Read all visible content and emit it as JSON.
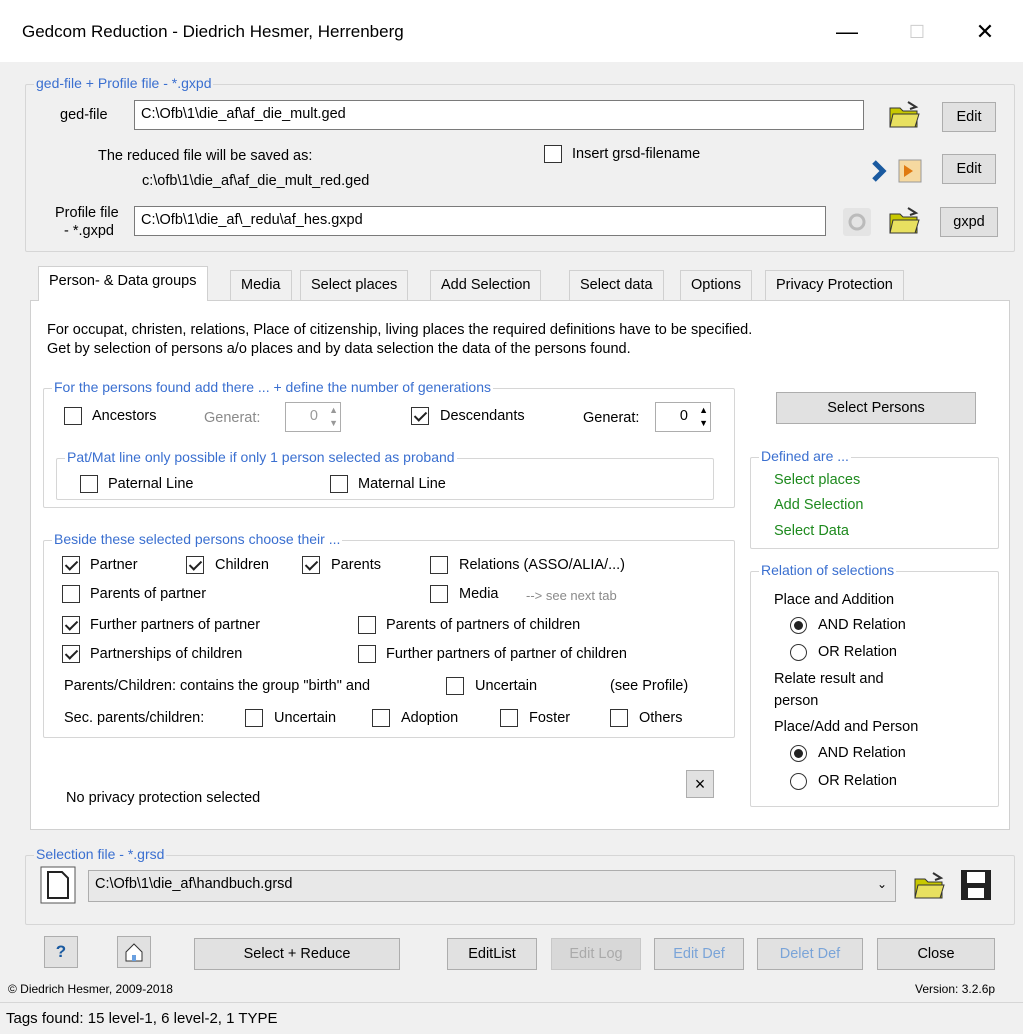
{
  "window": {
    "title": "Gedcom Reduction  -  Diedrich Hesmer, Herrenberg",
    "minimize": "—",
    "maximize": "☐",
    "close": "✕"
  },
  "files": {
    "legend": "ged-file + Profile file - *.gxpd",
    "ged_label": "ged-file",
    "ged_value": "C:\\Ofb\\1\\die_af\\af_die_mult.ged",
    "edit": "Edit",
    "saved_as_label": "The reduced file will be saved as:",
    "saved_as_value": "c:\\ofb\\1\\die_af\\af_die_mult_red.ged",
    "insert_grsd": "Insert grsd-filename",
    "profile_label_1": "Profile file",
    "profile_label_2": "- *.gxpd",
    "profile_value": "C:\\Ofb\\1\\die_af\\_redu\\af_hes.gxpd",
    "gxpd": "gxpd"
  },
  "tabs": [
    "Person- & Data groups",
    "Media",
    "Select places",
    "Add Selection",
    "Select data",
    "Options",
    "Privacy Protection"
  ],
  "intro": {
    "line1": "For occupat, christen, relations, Place of citizenship, living places the required definitions have to be specified.",
    "line2": "Get by selection of persons a/o places and by data selection the data of the persons found."
  },
  "generations": {
    "legend": "For the persons found add there ... + define the number of generations",
    "ancestors": "Ancestors",
    "generat_ancestors": "Generat:",
    "ancestors_value": "0",
    "descendants": "Descendants",
    "generat_descendants": "Generat:",
    "descendants_value": "0",
    "patmat_legend": "Pat/Mat line only possible if only 1 person selected as proband",
    "paternal": "Paternal Line",
    "maternal": "Maternal Line"
  },
  "beside": {
    "legend": "Beside these selected persons choose their ...",
    "partner": "Partner",
    "children": "Children",
    "parents": "Parents",
    "relations": "Relations (ASSO/ALIA/...)",
    "parents_of_partner": "Parents of partner",
    "media": "Media",
    "media_hint": "--> see next tab",
    "further_partners": "Further partners of partner",
    "parents_partners_children": "Parents of partners of children",
    "partnerships_children": "Partnerships of children",
    "further_partners_children": "Further partners of partner of children",
    "birth_text": "Parents/Children: contains the group \"birth\" and",
    "uncertain": "Uncertain",
    "see_profile": "(see Profile)",
    "sec_text": "Sec. parents/children:",
    "sec_uncertain": "Uncertain",
    "adoption": "Adoption",
    "foster": "Foster",
    "others": "Others"
  },
  "privacy": {
    "text": "No privacy protection selected",
    "clear": "×"
  },
  "right": {
    "select_persons": "Select Persons",
    "defined_legend": "Defined are ...",
    "defined_items": [
      "Select places",
      "Add Selection",
      "Select Data"
    ],
    "relation_legend": "Relation of selections",
    "place_addition": "Place and Addition",
    "and_relation_1": "AND Relation",
    "or_relation_1": "OR Relation",
    "relate_result_1": "Relate result and",
    "relate_result_2": "person",
    "place_add_person": "Place/Add and Person",
    "and_relation_2": "AND Relation",
    "or_relation_2": "OR Relation"
  },
  "selection": {
    "legend": "Selection file - *.grsd",
    "value": "C:\\Ofb\\1\\die_af\\handbuch.grsd"
  },
  "buttons": {
    "help": "?",
    "select_reduce": "Select + Reduce",
    "editlist": "EditList",
    "editlog": "Edit Log",
    "editdef": "Edit Def",
    "deletdef": "Delet Def",
    "close": "Close"
  },
  "footer": {
    "copyright": "© Diedrich Hesmer,  2009-2018",
    "version": "Version: 3.2.6p",
    "status": "Tags found:  15 level-1,  6 level-2,  1 TYPE"
  }
}
